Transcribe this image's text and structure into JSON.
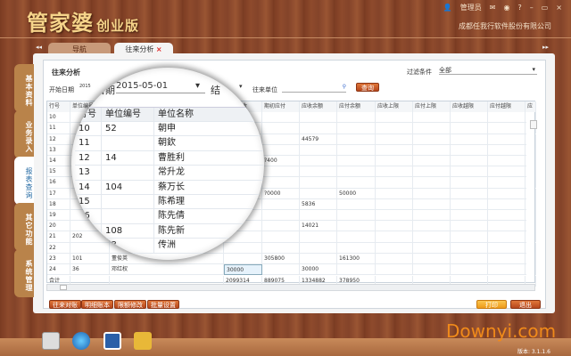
{
  "app": {
    "title": "管家婆",
    "edition": "创业版",
    "company": "成都任我行软件股份有限公司",
    "user": "管理员",
    "version": "版本: 3.1.1.6",
    "watermark": "Downyi.com"
  },
  "tabs": [
    {
      "label": "导航"
    },
    {
      "label": "往来分析",
      "close": "×"
    }
  ],
  "sidebar": [
    {
      "label": "基本资料"
    },
    {
      "label": "业务录入"
    },
    {
      "label": "报表查询",
      "active": true
    },
    {
      "label": "其它功能"
    },
    {
      "label": "系统管理"
    }
  ],
  "page": {
    "title": "往来分析",
    "filter_label": "过滤条件",
    "filter_value": "全部",
    "start_label": "开始日期",
    "start_value": "2015",
    "end_label": "结",
    "unit_label": "往来单位",
    "unit_value": "",
    "query": "查询"
  },
  "table": {
    "columns": [
      "行号",
      "单位编号",
      "单位名称",
      "期初应收",
      "期初应付",
      "应收余额",
      "应付余额",
      "应收上限",
      "应付上限",
      "应收越限",
      "应付越限",
      "应"
    ],
    "rows": [
      [
        "10",
        "",
        "",
        "",
        "",
        "",
        "",
        "",
        "",
        "",
        "",
        ""
      ],
      [
        "11",
        "",
        "",
        "",
        "",
        "",
        "",
        "",
        "",
        "",
        "",
        ""
      ],
      [
        "12",
        "",
        "",
        "",
        "",
        "44579",
        "",
        "",
        "",
        "",
        "",
        ""
      ],
      [
        "13",
        "",
        "",
        "",
        "",
        "",
        "",
        "",
        "",
        "",
        "",
        ""
      ],
      [
        "14",
        "",
        "",
        "",
        "?400",
        "",
        "",
        "",
        "",
        "",
        "",
        ""
      ],
      [
        "15",
        "",
        "",
        "",
        "",
        "",
        "",
        "",
        "",
        "",
        "",
        ""
      ],
      [
        "16",
        "",
        "",
        "",
        "",
        "",
        "",
        "",
        "",
        "",
        "",
        ""
      ],
      [
        "17",
        "",
        "",
        "",
        "?0000",
        "",
        "50000",
        "",
        "",
        "",
        "",
        ""
      ],
      [
        "18",
        "",
        "",
        "",
        "",
        "5836",
        "",
        "",
        "",
        "",
        "",
        ""
      ],
      [
        "19",
        "",
        "",
        "",
        "",
        "",
        "",
        "",
        "",
        "",
        "",
        ""
      ],
      [
        "20",
        "",
        "",
        "",
        "",
        "14021",
        "",
        "",
        "",
        "",
        "",
        ""
      ],
      [
        "21",
        "202",
        "",
        "",
        "",
        "",
        "",
        "",
        "",
        "",
        "",
        ""
      ],
      [
        "22",
        "",
        "",
        "",
        "",
        "",
        "",
        "",
        "",
        "",
        "",
        ""
      ],
      [
        "23",
        "101",
        "董俊英",
        "",
        "305800",
        "",
        "161300",
        "",
        "",
        "",
        "",
        ""
      ],
      [
        "24",
        "36",
        "邓红权",
        "30000",
        "",
        "30000",
        "",
        "",
        "",
        "",
        "",
        ""
      ]
    ],
    "total": [
      "合计",
      "",
      "",
      "2099314",
      "889075",
      "1334882",
      "378950",
      "",
      "",
      "",
      "",
      ""
    ]
  },
  "magnifier": {
    "date_label": "日期",
    "date_value": "2015-05-01",
    "end_label": "结",
    "columns": [
      "行号",
      "单位编号",
      "单位名称"
    ],
    "rows": [
      [
        "10",
        "52",
        "朝申"
      ],
      [
        "11",
        "",
        "朝欽"
      ],
      [
        "12",
        "14",
        "曹胜利"
      ],
      [
        "13",
        "",
        "常升龙"
      ],
      [
        "14",
        "104",
        "蔡万长"
      ],
      [
        "15",
        "",
        "陈希理"
      ],
      [
        "16",
        "",
        "陈先倩"
      ],
      [
        "17",
        "108",
        "陈先新"
      ],
      [
        "18",
        "98",
        "传洲"
      ]
    ]
  },
  "buttons": {
    "left": [
      "往来对账",
      "明细账本",
      "限额修改",
      "批量设置"
    ],
    "print": "打印",
    "exit": "退出"
  },
  "colors": {
    "accent": "#c0501f",
    "print": "#f0a020",
    "wood": "#8a4a2c"
  }
}
